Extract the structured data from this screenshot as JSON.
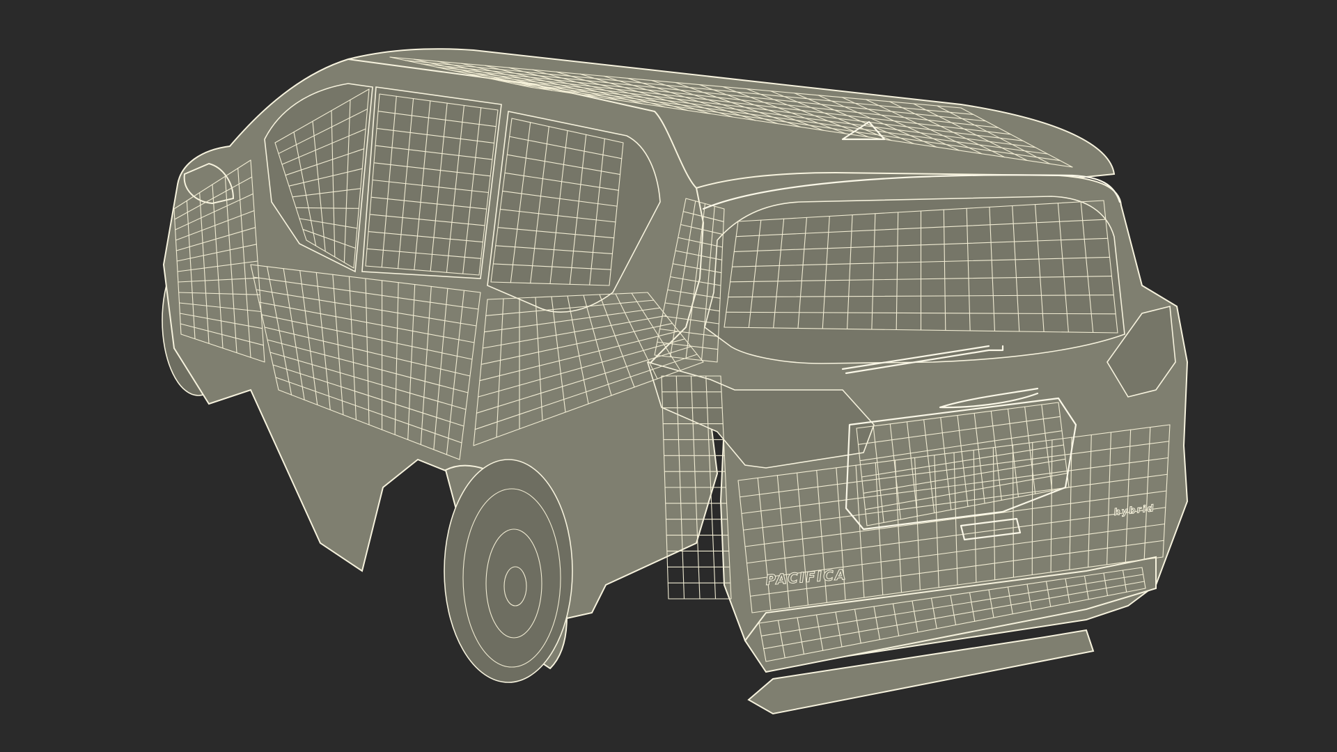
{
  "scene": {
    "background_color": "#2a2a2a",
    "mesh_fill_color": "#7f7f70",
    "wire_color": "#f2edd4",
    "subject": "wireframe-minivan"
  },
  "emblems": {
    "model_badge": "PACIFICA",
    "hybrid_badge": "hybrid"
  }
}
